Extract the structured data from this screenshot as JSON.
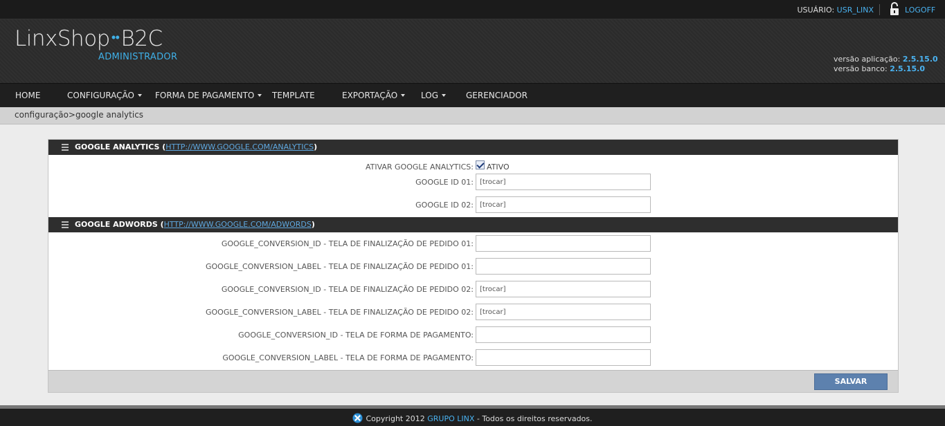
{
  "topbar": {
    "user_label": "USUÁRIO: ",
    "user_name": "USR_LINX",
    "logoff": "LOGOFF"
  },
  "header": {
    "logo_part1": "LinxShop",
    "logo_dots": "••",
    "logo_part2": "B2C",
    "logo_sub": "ADMINISTRADOR",
    "app_version_label": "versão aplicação:",
    "app_version": "2.5.15.0",
    "db_version_label": "versão banco:",
    "db_version": "2.5.15.0"
  },
  "nav": {
    "items": [
      {
        "label": "HOME"
      },
      {
        "label": "CONFIGURAÇÃO"
      },
      {
        "label": "FORMA DE PAGAMENTO"
      },
      {
        "label": "TEMPLATE"
      },
      {
        "label": "EXPORTAÇÃO"
      },
      {
        "label": "LOG"
      },
      {
        "label": "GERENCIADOR"
      }
    ]
  },
  "breadcrumb": "configuração>google analytics",
  "analytics": {
    "title": "GOOGLE ANALYTICS",
    "open_paren": " (",
    "link": "HTTP://WWW.GOOGLE.COM/ANALYTICS",
    "close_paren": ")",
    "active_label": "ATIVAR GOOGLE ANALYTICS:",
    "active_checkbox_label": "ATIVO",
    "active_checked": true,
    "fields": [
      {
        "label": "GOOGLE ID 01:",
        "value": "[trocar]"
      },
      {
        "label": "GOOGLE ID 02:",
        "value": "[trocar]"
      }
    ]
  },
  "adwords": {
    "title": "GOOGLE ADWORDS",
    "open_paren": " (",
    "link": "HTTP://WWW.GOOGLE.COM/ADWORDS",
    "close_paren": ")",
    "fields": [
      {
        "label": "GOOGLE_CONVERSION_ID - TELA DE FINALIZAÇÃO DE PEDIDO 01:",
        "value": ""
      },
      {
        "label": "GOOGLE_CONVERSION_LABEL - TELA DE FINALIZAÇÃO DE PEDIDO 01:",
        "value": ""
      },
      {
        "label": "GOOGLE_CONVERSION_ID - TELA DE FINALIZAÇÃO DE PEDIDO 02:",
        "value": "[trocar]"
      },
      {
        "label": "GOOGLE_CONVERSION_LABEL - TELA DE FINALIZAÇÃO DE PEDIDO 02:",
        "value": "[trocar]"
      },
      {
        "label": "GOOGLE_CONVERSION_ID - TELA DE FORMA DE PAGAMENTO:",
        "value": ""
      },
      {
        "label": "GOOGLE_CONVERSION_LABEL - TELA DE FORMA DE PAGAMENTO:",
        "value": ""
      }
    ]
  },
  "actions": {
    "save_label": "SALVAR"
  },
  "footer": {
    "copyright": "Copyright 2012 ",
    "brand": "GRUPO LINX",
    "rights": " - Todos os direitos reservados."
  },
  "colors": {
    "accent": "#4ab2f0",
    "header_bg": "#2b2b2b",
    "section_head_bg": "#2e2e2e",
    "save_button": "#5d81ae"
  }
}
